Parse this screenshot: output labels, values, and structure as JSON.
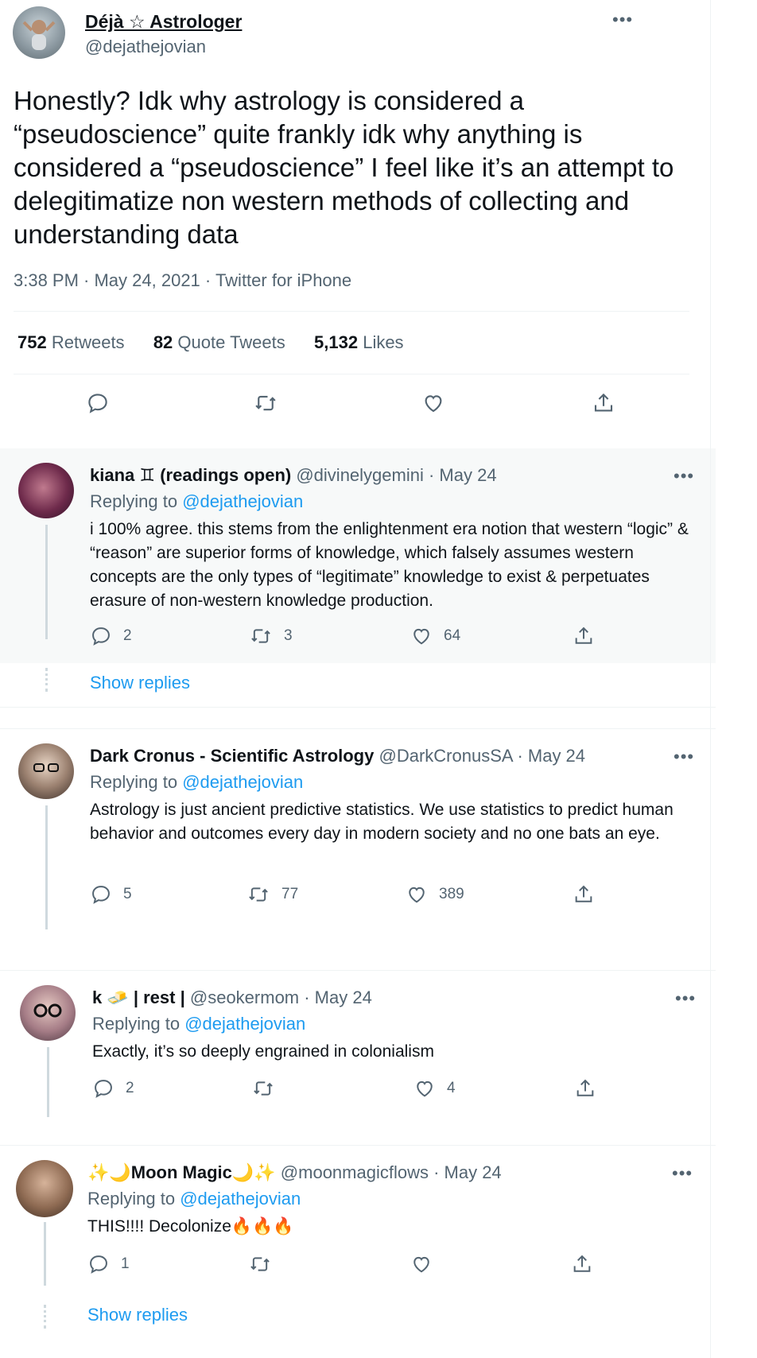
{
  "main_tweet": {
    "display_name": "Déjà ☆ Astrologer",
    "handle": "@dejathejovian",
    "text": "Honestly? Idk why astrology is considered a “pseudoscience” quite frankly idk why anything is considered a “pseudoscience” I feel like it’s an attempt to delegitimatize non western methods of collecting and understanding data",
    "meta": "3:38 PM · May 24, 2021 · Twitter for iPhone",
    "stats": {
      "retweets_count": "752",
      "retweets_label": "Retweets",
      "quotes_count": "82",
      "quotes_label": "Quote Tweets",
      "likes_count": "5,132",
      "likes_label": "Likes"
    },
    "more_label": "•••"
  },
  "replies": [
    {
      "name": "kiana ♊ (readings open)",
      "meta": "@divinelygemini · May 24",
      "replying_prefix": "Replying to",
      "replying_to": "@dejathejovian",
      "text": "i 100% agree. this stems from the enlightenment era notion that western “logic” & “reason” are superior forms of knowledge, which falsely assumes western concepts are the only types of “legitimate” knowledge to exist & perpetuates erasure of non-western knowledge production.",
      "replies": "2",
      "retweets": "3",
      "likes": "64",
      "show_replies": "Show replies"
    },
    {
      "name": "Dark Cronus - Scientific Astrology",
      "meta": "@DarkCronusSA · May 24",
      "replying_prefix": "Replying to",
      "replying_to": "@dejathejovian",
      "text": "Astrology is just ancient predictive statistics. We use statistics to predict human behavior and outcomes every day in modern society and no one bats an eye.",
      "replies": "5",
      "retweets": "77",
      "likes": "389"
    },
    {
      "name": "k 🧈 | rest |",
      "meta": "@seokermom · May 24",
      "replying_prefix": "Replying to",
      "replying_to": "@dejathejovian",
      "text": "Exactly, it’s so deeply engrained in colonialism",
      "replies": "2",
      "retweets": "",
      "likes": "4"
    },
    {
      "name": "✨🌙Moon Magic🌙✨",
      "meta": "@moonmagicflows · May 24",
      "replying_prefix": "Replying to",
      "replying_to": "@dejathejovian",
      "text": "THIS!!!! Decolonize🔥🔥🔥",
      "replies": "1",
      "retweets": "",
      "likes": "",
      "show_replies": "Show replies"
    }
  ],
  "colors": {
    "text": "#0f1419",
    "secondary": "#536471",
    "accent": "#1d9bf0",
    "line": "#cfd9de"
  },
  "icons": [
    "reply-icon",
    "retweet-icon",
    "like-icon",
    "share-icon",
    "more-icon"
  ]
}
